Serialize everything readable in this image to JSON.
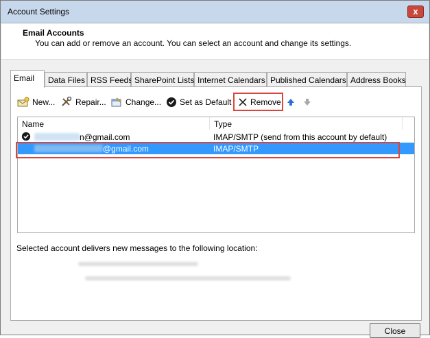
{
  "window": {
    "title": "Account Settings",
    "close_glyph": "x"
  },
  "header": {
    "title": "Email Accounts",
    "subtitle": "You can add or remove an account. You can select an account and change its settings."
  },
  "tabs": [
    {
      "label": "Email",
      "active": true
    },
    {
      "label": "Data Files"
    },
    {
      "label": "RSS Feeds"
    },
    {
      "label": "SharePoint Lists"
    },
    {
      "label": "Internet Calendars"
    },
    {
      "label": "Published Calendars"
    },
    {
      "label": "Address Books"
    }
  ],
  "toolbar": {
    "new_label": "New...",
    "repair_label": "Repair...",
    "change_label": "Change...",
    "default_label": "Set as Default",
    "remove_label": "Remove",
    "icons": {
      "new": "new-account-icon",
      "repair": "repair-tools-icon",
      "change": "change-icon",
      "default": "checkmark-circle-icon",
      "remove": "x-remove-icon",
      "up": "arrow-up-icon",
      "down": "arrow-down-icon"
    }
  },
  "accounts": {
    "columns": [
      "Name",
      "Type"
    ],
    "rows": [
      {
        "name": "n@gmail.com",
        "type": "IMAP/SMTP (send from this account by default)",
        "default": true,
        "selected": false
      },
      {
        "name": "@gmail.com",
        "type": "IMAP/SMTP",
        "default": false,
        "selected": true
      }
    ]
  },
  "delivery": {
    "label": "Selected account delivers new messages to the following location:"
  },
  "footer": {
    "close_label": "Close"
  },
  "colors": {
    "selection": "#3399ff",
    "highlight_box": "#d9473c",
    "titlebar": "#c8d8ec",
    "arrow_up": "#2e6fd8"
  }
}
